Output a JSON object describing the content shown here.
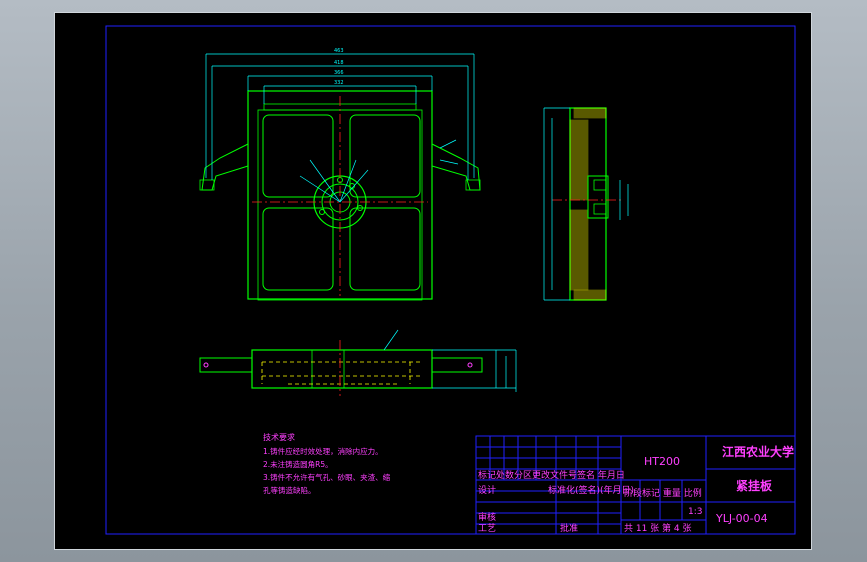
{
  "drawing": {
    "material": "HT200",
    "university": "江西农业大学",
    "part_name": "紧挂板",
    "drawing_number": "YLJ-00-04",
    "scale": "1:3",
    "sheet_info": "共 11 张 第 4 张"
  },
  "title_block": {
    "row1": "标记处数分区更改文件号签名 年月日",
    "row2_left": "设计",
    "row2_right": "标准化(签名)(年月日)",
    "row2_tail": "阶段标记 重量 比例",
    "row3_left": "审核",
    "row4_left": "工艺",
    "row4_mid": "批准"
  },
  "technical_requirements": {
    "heading": "技术要求",
    "lines": [
      "1.铸件应经时效处理，消除内应力。",
      "2.未注铸造圆角R5。",
      "3.铸件不允许有气孔、砂眼、夹渣、缩",
      "孔等铸造缺陷。"
    ]
  },
  "colors": {
    "geometry": "#00ff00",
    "dimensions": "#00ffff",
    "text": "#ff40ff",
    "border": "#2020ff",
    "center_lines": "#ff2020",
    "hidden": "#ffff00",
    "hatch": "#ffff00"
  }
}
